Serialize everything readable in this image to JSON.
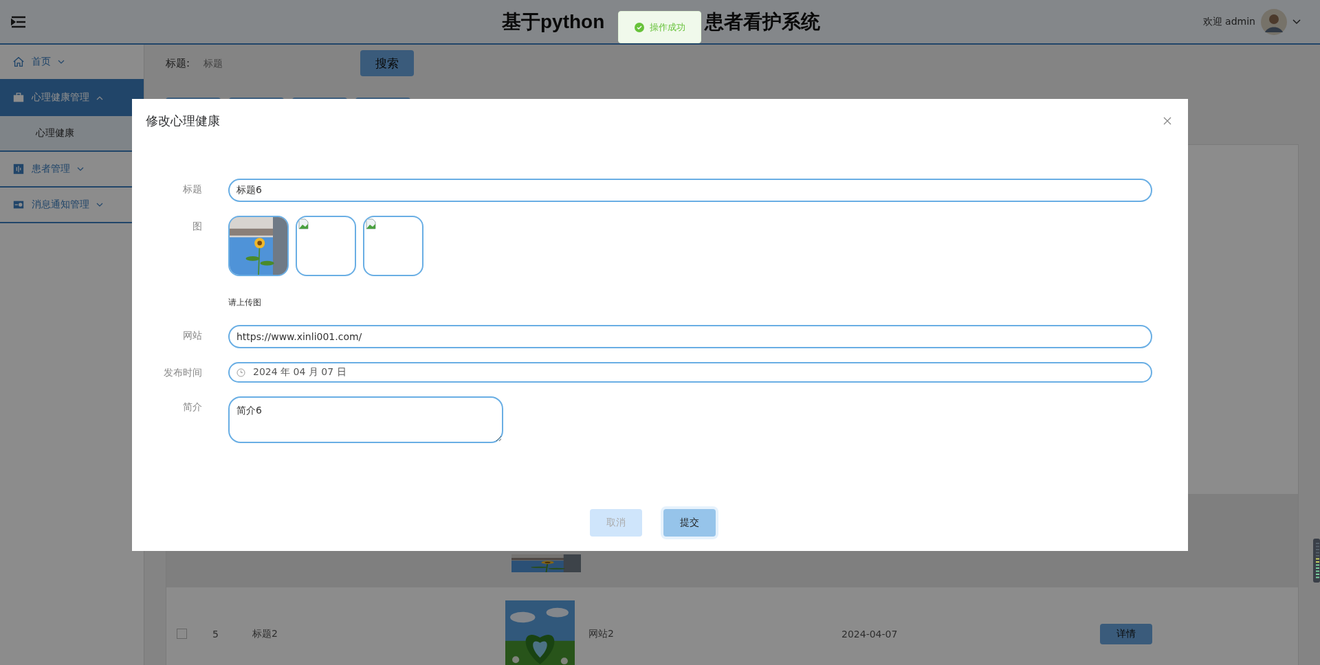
{
  "header": {
    "title_parts": [
      "基于python",
      "患者看护系统"
    ],
    "welcome": "欢迎 admin"
  },
  "toast": {
    "message": "操作成功"
  },
  "sidebar": {
    "items": [
      {
        "label": "首页",
        "expanded": false,
        "selected": false
      },
      {
        "label": "心理健康管理",
        "expanded": true,
        "selected": true,
        "children": [
          {
            "label": "心理健康",
            "selected": true
          }
        ]
      },
      {
        "label": "患者管理",
        "expanded": false,
        "selected": false
      },
      {
        "label": "消息通知管理",
        "expanded": false,
        "selected": false
      }
    ]
  },
  "search": {
    "label": "标题:",
    "placeholder": "标题",
    "button": "搜索"
  },
  "table": {
    "rows": [
      {
        "picture": {
          "kind": "picture"
        }
      },
      {
        "checked": false,
        "number": "5",
        "title": "标题2",
        "picture": {
          "kind": "picture"
        },
        "website": "网站2",
        "date": "2024-04-07",
        "button": "详情"
      }
    ]
  },
  "dialog": {
    "title": "修改心理健康",
    "fields": [
      {
        "kind": "text",
        "label": "标题",
        "value": "标题6"
      },
      {
        "kind": "images",
        "label": "图",
        "images": [
          {
            "kind": "picture"
          },
          {
            "kind": "broken"
          },
          {
            "kind": "broken"
          }
        ],
        "hint": "请上传图"
      },
      {
        "kind": "text",
        "label": "网站",
        "value": "https://www.xinli001.com/"
      },
      {
        "kind": "date",
        "label": "发布时间",
        "value": "2024 年 04 月 07 日"
      },
      {
        "kind": "textarea",
        "label": "简介",
        "value": "简介6"
      }
    ],
    "buttons": [
      {
        "kind": "cancel",
        "label": "取消"
      },
      {
        "kind": "submit",
        "label": "提交"
      }
    ]
  }
}
